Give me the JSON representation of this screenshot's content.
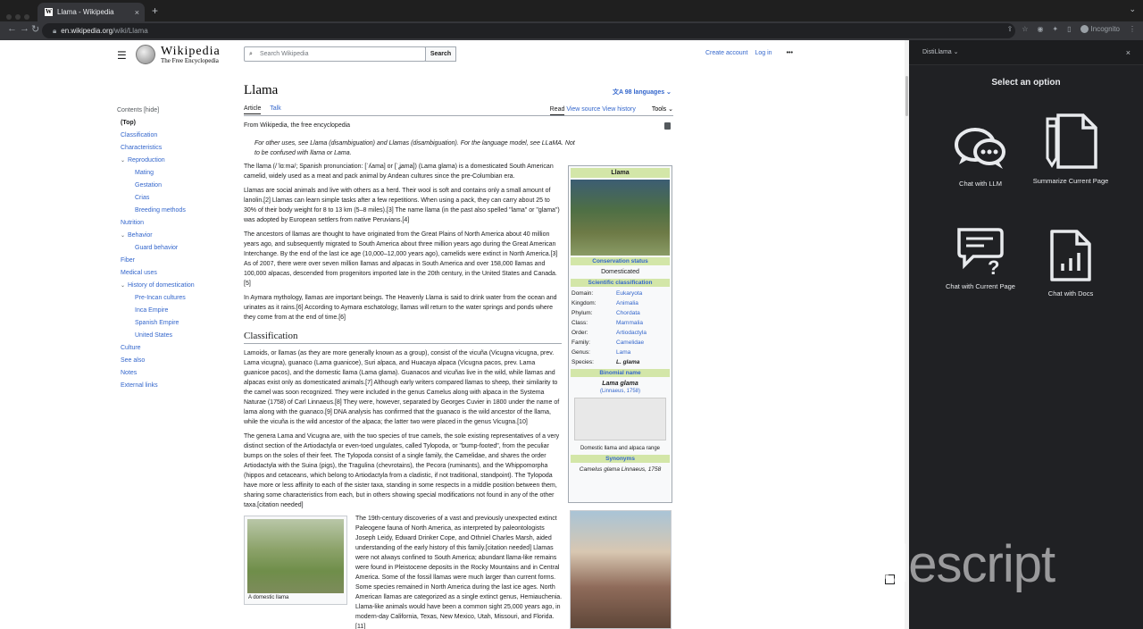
{
  "browser": {
    "tab_title": "Llama - Wikipedia",
    "url_domain": "en.wikipedia.org",
    "url_path": "/wiki/Llama",
    "incognito_label": "Incognito"
  },
  "wiki": {
    "brand": "Wikipedia",
    "tagline": "The Free Encyclopedia",
    "search_placeholder": "Search Wikipedia",
    "search_button": "Search",
    "create_account": "Create account",
    "log_in": "Log in",
    "toc": {
      "header": "Contents [hide]",
      "items": [
        {
          "label": "(Top)",
          "level": 1,
          "top": true
        },
        {
          "label": "Classification",
          "level": 1
        },
        {
          "label": "Characteristics",
          "level": 1
        },
        {
          "label": "Reproduction",
          "level": 1,
          "caret": true
        },
        {
          "label": "Mating",
          "level": 2
        },
        {
          "label": "Gestation",
          "level": 2
        },
        {
          "label": "Crias",
          "level": 2
        },
        {
          "label": "Breeding methods",
          "level": 2
        },
        {
          "label": "Nutrition",
          "level": 1
        },
        {
          "label": "Behavior",
          "level": 1,
          "caret": true
        },
        {
          "label": "Guard behavior",
          "level": 2
        },
        {
          "label": "Fiber",
          "level": 1
        },
        {
          "label": "Medical uses",
          "level": 1
        },
        {
          "label": "History of domestication",
          "level": 1,
          "caret": true
        },
        {
          "label": "Pre-Incan cultures",
          "level": 2
        },
        {
          "label": "Inca Empire",
          "level": 2
        },
        {
          "label": "Spanish Empire",
          "level": 2
        },
        {
          "label": "United States",
          "level": 2
        },
        {
          "label": "Culture",
          "level": 1
        },
        {
          "label": "See also",
          "level": 1
        },
        {
          "label": "Notes",
          "level": 1
        },
        {
          "label": "External links",
          "level": 1
        }
      ]
    },
    "title": "Llama",
    "languages": "98 languages",
    "tabs": {
      "article": "Article",
      "talk": "Talk",
      "read": "Read",
      "view_source": "View source",
      "view_history": "View history",
      "tools": "Tools"
    },
    "from": "From Wikipedia, the free encyclopedia",
    "hatnote": "For other uses, see Llama (disambiguation) and Llamas (disambiguation). For the language model, see LLaMA. Not to be confused with llama or Lama.",
    "paragraphs": [
      "The llama (/ˈlɑːmə/; Spanish pronunciation: [ˈʎama] or [ˈʝama]) (Lama glama) is a domesticated South American camelid, widely used as a meat and pack animal by Andean cultures since the pre-Columbian era.",
      "Llamas are social animals and live with others as a herd. Their wool is soft and contains only a small amount of lanolin.[2] Llamas can learn simple tasks after a few repetitions. When using a pack, they can carry about 25 to 30% of their body weight for 8 to 13 km (5–8 miles).[3] The name llama (in the past also spelled \"lama\" or \"glama\") was adopted by European settlers from native Peruvians.[4]",
      "The ancestors of llamas are thought to have originated from the Great Plains of North America about 40 million years ago, and subsequently migrated to South America about three million years ago during the Great American Interchange. By the end of the last ice age (10,000–12,000 years ago), camelids were extinct in North America.[3] As of 2007, there were over seven million llamas and alpacas in South America and over 158,000 llamas and 100,000 alpacas, descended from progenitors imported late in the 20th century, in the United States and Canada.[5]",
      "In Aymara mythology, llamas are important beings. The Heavenly Llama is said to drink water from the ocean and urinates as it rains.[6] According to Aymara eschatology, llamas will return to the water springs and ponds where they come from at the end of time.[6]"
    ],
    "section_heading": "Classification",
    "class_paragraphs": [
      "Lamoids, or llamas (as they are more generally known as a group), consist of the vicuña (Vicugna vicugna, prev. Lama vicugna), guanaco (Lama guanicoe), Suri alpaca, and Huacaya alpaca (Vicugna pacos, prev. Lama guanicoe pacos), and the domestic llama (Lama glama). Guanacos and vicuñas live in the wild, while llamas and alpacas exist only as domesticated animals.[7] Although early writers compared llamas to sheep, their similarity to the camel was soon recognized. They were included in the genus Camelus along with alpaca in the Systema Naturae (1758) of Carl Linnaeus.[8] They were, however, separated by Georges Cuvier in 1800 under the name of lama along with the guanaco.[9] DNA analysis has confirmed that the guanaco is the wild ancestor of the llama, while the vicuña is the wild ancestor of the alpaca; the latter two were placed in the genus Vicugna.[10]",
      "The genera Lama and Vicugna are, with the two species of true camels, the sole existing representatives of a very distinct section of the Artiodactyla or even-toed ungulates, called Tylopoda, or \"bump-footed\", from the peculiar bumps on the soles of their feet. The Tylopoda consist of a single family, the Camelidae, and shares the order Artiodactyla with the Suina (pigs), the Tragulina (chevrotains), the Pecora (ruminants), and the Whippomorpha (hippos and cetaceans, which belong to Artiodactyla from a cladistic, if not traditional, standpoint). The Tylopoda have more or less affinity to each of the sister taxa, standing in some respects in a middle position between them, sharing some characteristics from each, but in others showing special modifications not found in any of the other taxa.[citation needed]"
    ],
    "lower_paragraph": "The 19th-century discoveries of a vast and previously unexpected extinct Paleogene fauna of North America, as interpreted by paleontologists Joseph Leidy, Edward Drinker Cope, and Othniel Charles Marsh, aided understanding of the early history of this family.[citation needed] Llamas were not always confined to South America; abundant llama-like remains were found in Pleistocene deposits in the Rocky Mountains and in Central America. Some of the fossil llamas were much larger than current forms. Some species remained in North America during the last ice ages. North American llamas are categorized as a single extinct genus, Hemiauchenia. Llama-like animals would have been a common sight 25,000 years ago, in modern-day California, Texas, New Mexico, Utah, Missouri, and Florida.[11]",
    "thumb_caption": "A domestic llama",
    "infobox": {
      "title": "Llama",
      "conservation_status": "Conservation status",
      "conservation_value": "Domesticated",
      "sci_class": "Scientific classification",
      "rows": [
        {
          "k": "Domain:",
          "v": "Eukaryota"
        },
        {
          "k": "Kingdom:",
          "v": "Animalia"
        },
        {
          "k": "Phylum:",
          "v": "Chordata"
        },
        {
          "k": "Class:",
          "v": "Mammalia"
        },
        {
          "k": "Order:",
          "v": "Artiodactyla"
        },
        {
          "k": "Family:",
          "v": "Camelidae"
        },
        {
          "k": "Genus:",
          "v": "Lama"
        },
        {
          "k": "Species:",
          "v": "L. glama"
        }
      ],
      "binomial": "Binomial name",
      "binomial_value": "Lama glama",
      "authority": "(Linnaeus, 1758)",
      "map_caption": "Domestic llama and alpaca range",
      "synonyms": "Synonyms",
      "synonym_value": "Camelus glama Linnaeus, 1758"
    }
  },
  "panel": {
    "header": "DistiLlama",
    "heading": "Select an option",
    "options": [
      {
        "label": "Chat with LLM",
        "icon": "chat-bubbles-icon"
      },
      {
        "label": "Summarize Current Page",
        "icon": "document-pen-icon"
      },
      {
        "label": "Chat with Current Page",
        "icon": "chat-question-icon"
      },
      {
        "label": "Chat with Docs",
        "icon": "document-chart-icon"
      }
    ]
  },
  "watermark": "descript"
}
